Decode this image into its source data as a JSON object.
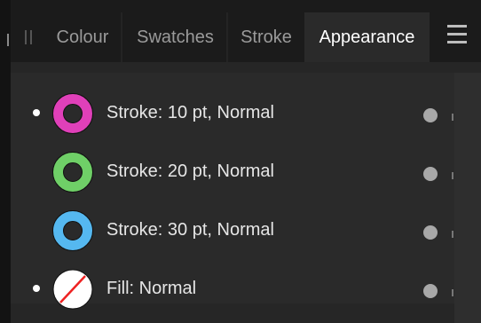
{
  "tabs": [
    {
      "label": "Colour",
      "active": false
    },
    {
      "label": "Swatches",
      "active": false
    },
    {
      "label": "Stroke",
      "active": false
    },
    {
      "label": "Appearance",
      "active": true
    }
  ],
  "appearance_items": [
    {
      "label": "Stroke: 10 pt, Normal",
      "selected": true,
      "swatch": "ring",
      "color": "#e040b9"
    },
    {
      "label": "Stroke: 20 pt, Normal",
      "selected": false,
      "swatch": "ring",
      "color": "#6fcf67"
    },
    {
      "label": "Stroke: 30 pt, Normal",
      "selected": false,
      "swatch": "ring",
      "color": "#55b8f0"
    },
    {
      "label": "Fill: Normal",
      "selected": true,
      "swatch": "none-fill",
      "color": "#ffffff"
    }
  ],
  "icons": {
    "menu": "hamburger-icon",
    "grip": "panel-grip-icon",
    "visibility": "visibility-dot-icon"
  }
}
